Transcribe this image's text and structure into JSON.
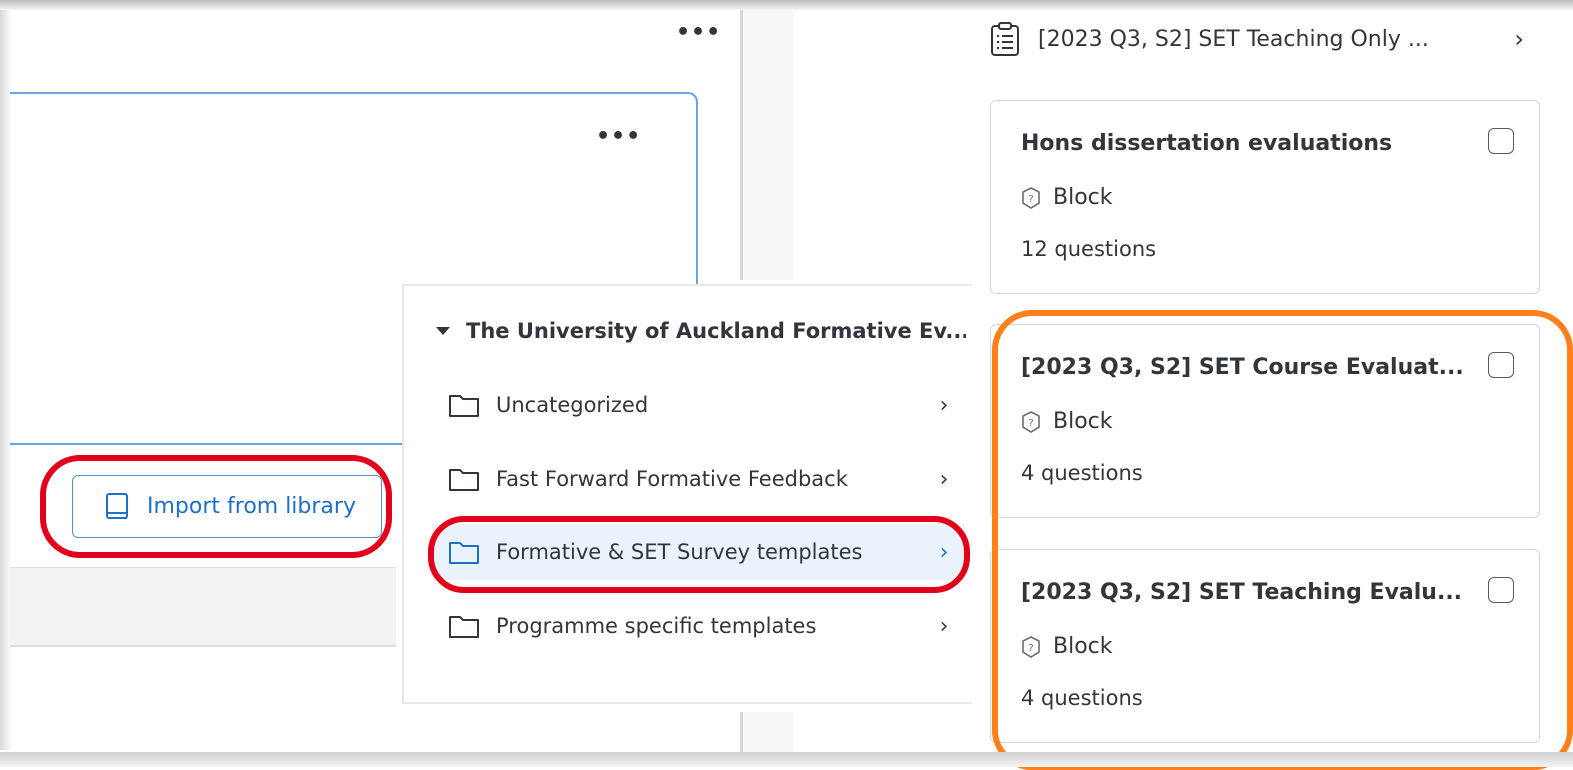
{
  "editor": {
    "top_more_label": "•••",
    "block_more_label": "•••",
    "import_button_label": "Import from library"
  },
  "library_panel": {
    "title": "The University of Auckland Formative Ev...",
    "folders": [
      {
        "label": "Uncategorized",
        "selected": false
      },
      {
        "label": "Fast Forward Formative Feedback",
        "selected": false
      },
      {
        "label": "Formative & SET Survey templates",
        "selected": true
      },
      {
        "label": "Programme specific templates",
        "selected": false
      }
    ]
  },
  "question_list": {
    "survey_title": "[2023 Q3, S2] SET Teaching Only ...",
    "blocks": [
      {
        "title": "Hons dissertation evaluations",
        "type": "Block",
        "count": "12 questions"
      },
      {
        "title": "[2023 Q3, S2] SET Course Evaluat...",
        "type": "Block",
        "count": "4 questions"
      },
      {
        "title": "[2023 Q3, S2] SET Teaching Evalu...",
        "type": "Block",
        "count": "4 questions"
      }
    ]
  },
  "colors": {
    "accent_blue": "#1f6fc9",
    "highlight_red": "#e3001b",
    "highlight_orange": "#ff7f1a",
    "selected_row": "#eaf3fc"
  }
}
